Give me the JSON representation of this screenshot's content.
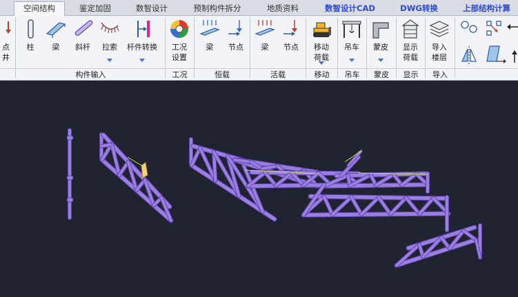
{
  "tabs": [
    {
      "label": "空间结构",
      "active": true
    },
    {
      "label": "鉴定加固"
    },
    {
      "label": "数智设计"
    },
    {
      "label": "预制构件拆分"
    },
    {
      "label": "地质资料"
    },
    {
      "label": "数智设计CAD",
      "special": true
    },
    {
      "label": "DWG转换",
      "special": true
    },
    {
      "label": "上部结构计算",
      "special": true
    }
  ],
  "tools": {
    "node_partial": {
      "label": "点\n井"
    },
    "column": {
      "label": "柱"
    },
    "beam": {
      "label": "梁"
    },
    "brace": {
      "label": "斜杆"
    },
    "cable": {
      "label": "拉索"
    },
    "member_convert": {
      "label": "杆件转换"
    },
    "load_case_setting": {
      "label": "工况\n设置"
    },
    "dead_beam": {
      "label": "梁"
    },
    "dead_node": {
      "label": "节点"
    },
    "live_beam": {
      "label": "梁"
    },
    "live_node": {
      "label": "节点"
    },
    "moving_load": {
      "label": "移动\n荷载"
    },
    "crane": {
      "label": "吊车"
    },
    "skin": {
      "label": "蒙皮"
    },
    "display_load": {
      "label": "显示\n荷载"
    },
    "import_floor": {
      "label": "导入\n楼层"
    }
  },
  "groups": {
    "member_input": "构件输入",
    "load_case": "工况",
    "dead_load": "恒载",
    "live_load": "活载",
    "move": "移动",
    "crane": "吊车",
    "skin": "蒙皮",
    "display": "显示",
    "import": "导入"
  },
  "colors": {
    "member": "#9b7fe0",
    "member_dark": "#5f44b0",
    "cable": "#c9e15a",
    "canvas_bg": "#1f2430",
    "ribbon_bg": "#f1f3f6",
    "special_tab": "#2f49d0",
    "dropdown_arrow": "#3b73d6"
  }
}
